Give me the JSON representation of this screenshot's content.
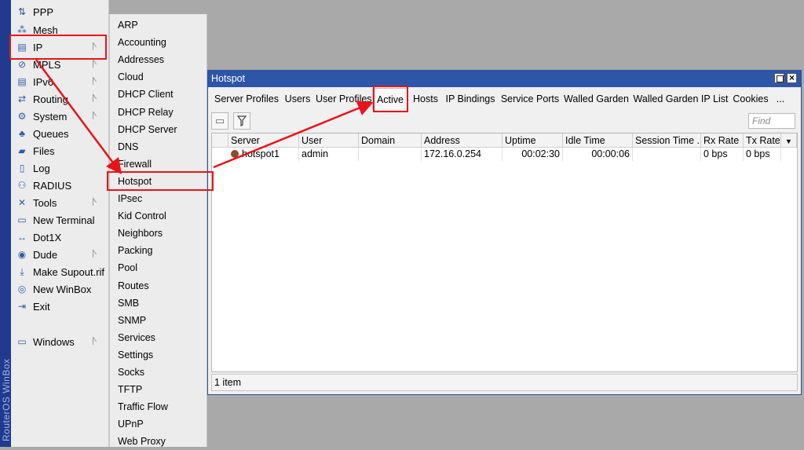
{
  "brand": "RouterOS WinBox",
  "main_menu": {
    "items": [
      {
        "label": "PPP",
        "icon": "ppp-icon",
        "glyph": "⇅",
        "submenu": false
      },
      {
        "label": "Mesh",
        "icon": "mesh-icon",
        "glyph": "⁂",
        "submenu": false
      },
      {
        "label": "IP",
        "icon": "ip-icon",
        "glyph": "▤",
        "submenu": true
      },
      {
        "label": "MPLS",
        "icon": "mpls-icon",
        "glyph": "⊘",
        "submenu": true
      },
      {
        "label": "IPv6",
        "icon": "ipv6-icon",
        "glyph": "▤",
        "submenu": true
      },
      {
        "label": "Routing",
        "icon": "routing-icon",
        "glyph": "⇄",
        "submenu": true
      },
      {
        "label": "System",
        "icon": "system-icon",
        "glyph": "⚙",
        "submenu": true
      },
      {
        "label": "Queues",
        "icon": "queues-icon",
        "glyph": "♣",
        "submenu": false
      },
      {
        "label": "Files",
        "icon": "folder-icon",
        "glyph": "▰",
        "submenu": false
      },
      {
        "label": "Log",
        "icon": "log-icon",
        "glyph": "▯",
        "submenu": false
      },
      {
        "label": "RADIUS",
        "icon": "radius-icon",
        "glyph": "⚇",
        "submenu": false
      },
      {
        "label": "Tools",
        "icon": "tools-icon",
        "glyph": "✕",
        "submenu": true
      },
      {
        "label": "New Terminal",
        "icon": "terminal-icon",
        "glyph": "▭",
        "submenu": false
      },
      {
        "label": "Dot1X",
        "icon": "dot1x-icon",
        "glyph": "↔",
        "submenu": false
      },
      {
        "label": "Dude",
        "icon": "dude-icon",
        "glyph": "◉",
        "submenu": true
      },
      {
        "label": "Make Supout.rif",
        "icon": "supout-icon",
        "glyph": "⤓",
        "submenu": false
      },
      {
        "label": "New WinBox",
        "icon": "winbox-icon",
        "glyph": "◎",
        "submenu": false
      },
      {
        "label": "Exit",
        "icon": "exit-icon",
        "glyph": "⇥",
        "submenu": false
      },
      {
        "label": "Windows",
        "icon": "windows-icon",
        "glyph": "▭",
        "submenu": true
      }
    ]
  },
  "ip_submenu": {
    "items": [
      "ARP",
      "Accounting",
      "Addresses",
      "Cloud",
      "DHCP Client",
      "DHCP Relay",
      "DHCP Server",
      "DNS",
      "Firewall",
      "Hotspot",
      "IPsec",
      "Kid Control",
      "Neighbors",
      "Packing",
      "Pool",
      "Routes",
      "SMB",
      "SNMP",
      "Services",
      "Settings",
      "Socks",
      "TFTP",
      "Traffic Flow",
      "UPnP",
      "Web Proxy"
    ]
  },
  "window": {
    "title": "Hotspot",
    "tabs": [
      "Server Profiles",
      "Users",
      "User Profiles",
      "Active",
      "Hosts",
      "IP Bindings",
      "Service Ports",
      "Walled Garden",
      "Walled Garden IP List",
      "Cookies",
      "..."
    ],
    "active_tab": "Active",
    "find_placeholder": "Find",
    "columns": [
      "Server",
      "User",
      "Domain",
      "Address",
      "Uptime",
      "Idle Time",
      "Session Time ...",
      "Rx Rate",
      "Tx Rate"
    ],
    "rows": [
      {
        "server": "hotspot1",
        "user": "admin",
        "domain": "",
        "address": "172.16.0.254",
        "uptime": "00:02:30",
        "idle_time": "00:00:06",
        "session_time": "",
        "rx_rate": "0 bps",
        "tx_rate": "0 bps"
      }
    ],
    "status": "1 item"
  },
  "colors": {
    "annotation_red": "#e8141b",
    "title_bar_blue": "#2e56a8",
    "brand_strip_blue": "#1f3a8f",
    "desktop_gray": "#a9a9a9"
  }
}
